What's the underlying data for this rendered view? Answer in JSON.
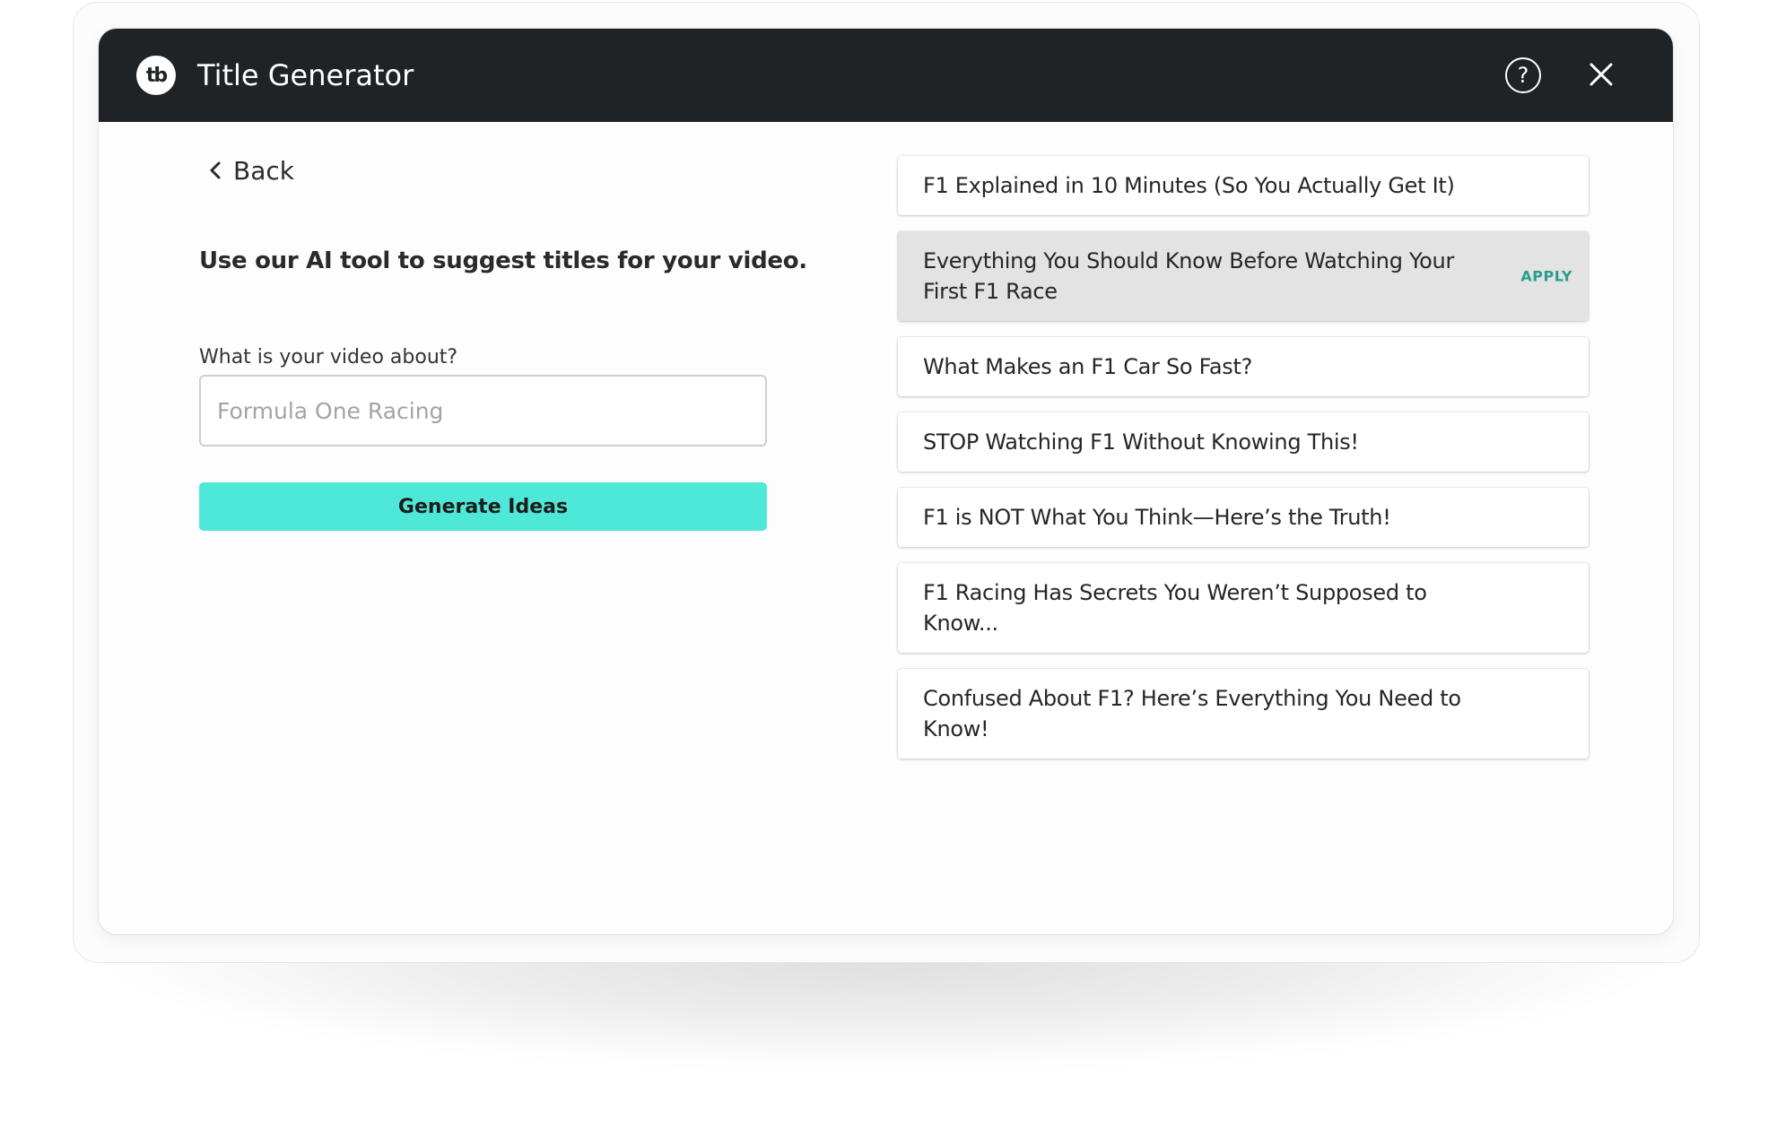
{
  "header": {
    "logo_text": "tb",
    "title": "Title Generator",
    "help_label": "?",
    "icons": {
      "logo": "tubebuddy-logo-icon",
      "help": "help-circle-icon",
      "close": "close-icon"
    }
  },
  "nav": {
    "back_label": "Back",
    "back_icon": "chevron-left-icon"
  },
  "form": {
    "intro": "Use our AI tool to suggest titles for your video.",
    "topic_label": "What is your video about?",
    "topic_placeholder": "Formula One Racing",
    "topic_value": "",
    "generate_label": "Generate Ideas",
    "generate_color": "#4de8d8"
  },
  "suggestions": {
    "apply_label": "APPLY",
    "apply_color": "#2a9d8f",
    "hovered_index": 1,
    "items": [
      {
        "text": "F1 Explained in 10 Minutes (So You Actually Get It)"
      },
      {
        "text": "Everything You Should Know Before Watching Your First F1 Race"
      },
      {
        "text": "What Makes an F1 Car So Fast?"
      },
      {
        "text": "STOP Watching F1 Without Knowing This!"
      },
      {
        "text": "F1 is NOT What You Think—Here’s the Truth!"
      },
      {
        "text": "F1 Racing Has Secrets You Weren’t Supposed to Know..."
      },
      {
        "text": "Confused About F1? Here’s Everything You Need to Know!"
      }
    ]
  },
  "colors": {
    "header_bg": "#1f2326",
    "hover_bg": "#e3e3e3"
  }
}
